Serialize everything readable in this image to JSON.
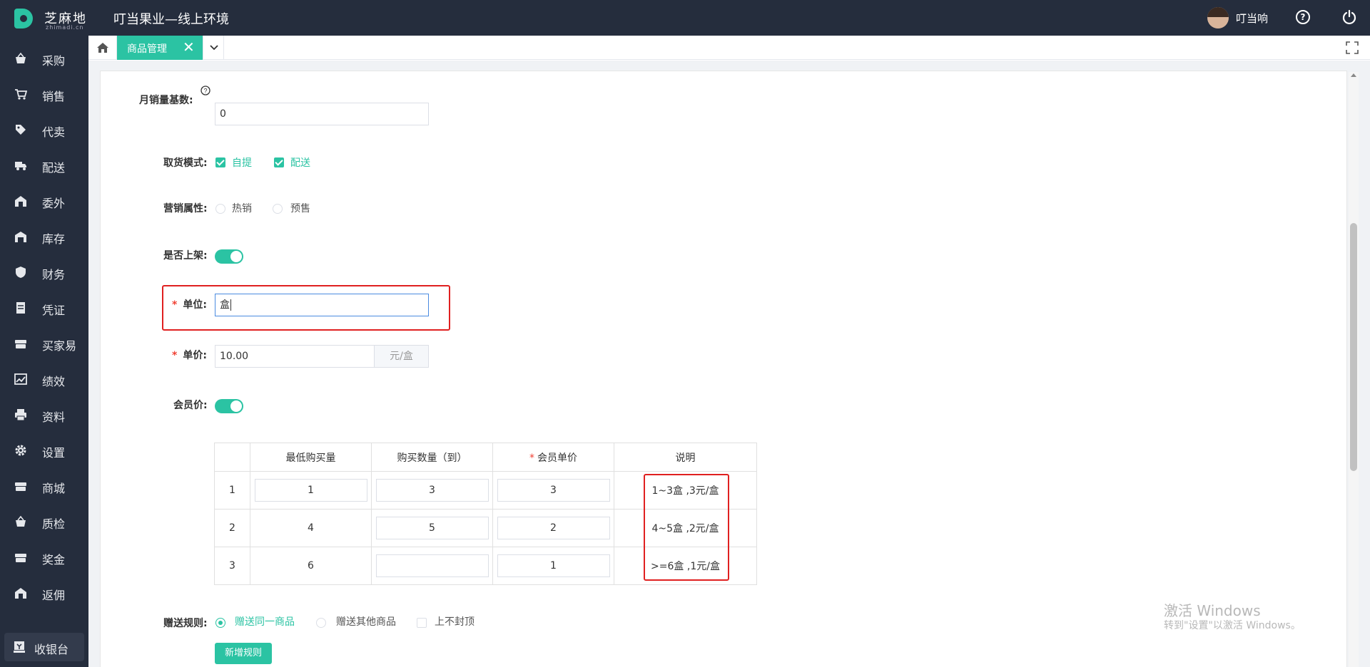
{
  "header": {
    "logo_name": "芝麻地",
    "logo_sub": "zhimadi.cn",
    "app_title": "叮当果业—线上环境",
    "user_name": "叮当响",
    "help_icon": "?"
  },
  "sidebar": {
    "items": [
      {
        "label": "采购",
        "icon": "basket-icon"
      },
      {
        "label": "销售",
        "icon": "cart-icon"
      },
      {
        "label": "代卖",
        "icon": "tag-icon"
      },
      {
        "label": "配送",
        "icon": "truck-icon"
      },
      {
        "label": "委外",
        "icon": "building-icon"
      },
      {
        "label": "库存",
        "icon": "warehouse-icon"
      },
      {
        "label": "财务",
        "icon": "shield-icon"
      },
      {
        "label": "凭证",
        "icon": "ledger-icon"
      },
      {
        "label": "买家易",
        "icon": "box-icon"
      },
      {
        "label": "绩效",
        "icon": "chart-icon"
      },
      {
        "label": "资料",
        "icon": "printer-icon"
      },
      {
        "label": "设置",
        "icon": "gear-icon"
      },
      {
        "label": "商城",
        "icon": "store-icon"
      },
      {
        "label": "质检",
        "icon": "basket-icon"
      },
      {
        "label": "奖金",
        "icon": "box-icon"
      },
      {
        "label": "返佣",
        "icon": "building-icon"
      }
    ],
    "cashier_label": "收银台"
  },
  "tabs": {
    "active_label": "商品管理",
    "close_icon": "✕"
  },
  "form": {
    "monthly_sales_label": "月销量基数:",
    "monthly_sales_value": "0",
    "pickup_label": "取货模式:",
    "pickup_options": [
      "自提",
      "配送"
    ],
    "marketing_label": "营销属性:",
    "marketing_options": [
      "热销",
      "预售"
    ],
    "on_shelf_label": "是否上架:",
    "on_shelf": true,
    "unit_label": "单位:",
    "unit_value": "盒",
    "price_label": "单价:",
    "price_value": "10.00",
    "price_unit": "元/盒",
    "member_price_label": "会员价:",
    "member_price": true,
    "gift_label": "赠送规则:",
    "gift_options": [
      "赠送同一商品",
      "赠送其他商品"
    ],
    "gift_cap_label": "上不封顶",
    "add_rule_button": "新增规则"
  },
  "table": {
    "headers": [
      "最低购买量",
      "购买数量（到）",
      "会员单价",
      "说明"
    ],
    "rows": [
      {
        "idx": "1",
        "min": "1",
        "max": "3",
        "price": "3",
        "desc": "1~3盒 ,3元/盒"
      },
      {
        "idx": "2",
        "min": "4",
        "max": "5",
        "price": "2",
        "desc": "4~5盒 ,2元/盒"
      },
      {
        "idx": "3",
        "min": "6",
        "max": "",
        "price": "1",
        "desc": ">=6盒 ,1元/盒"
      }
    ]
  },
  "watermark": {
    "line1": "激活 Windows",
    "line2": "转到\"设置\"以激活 Windows。"
  },
  "colors": {
    "accent": "#2bc3a3",
    "sidebar_bg": "#252d3d",
    "highlight": "#e02020"
  }
}
